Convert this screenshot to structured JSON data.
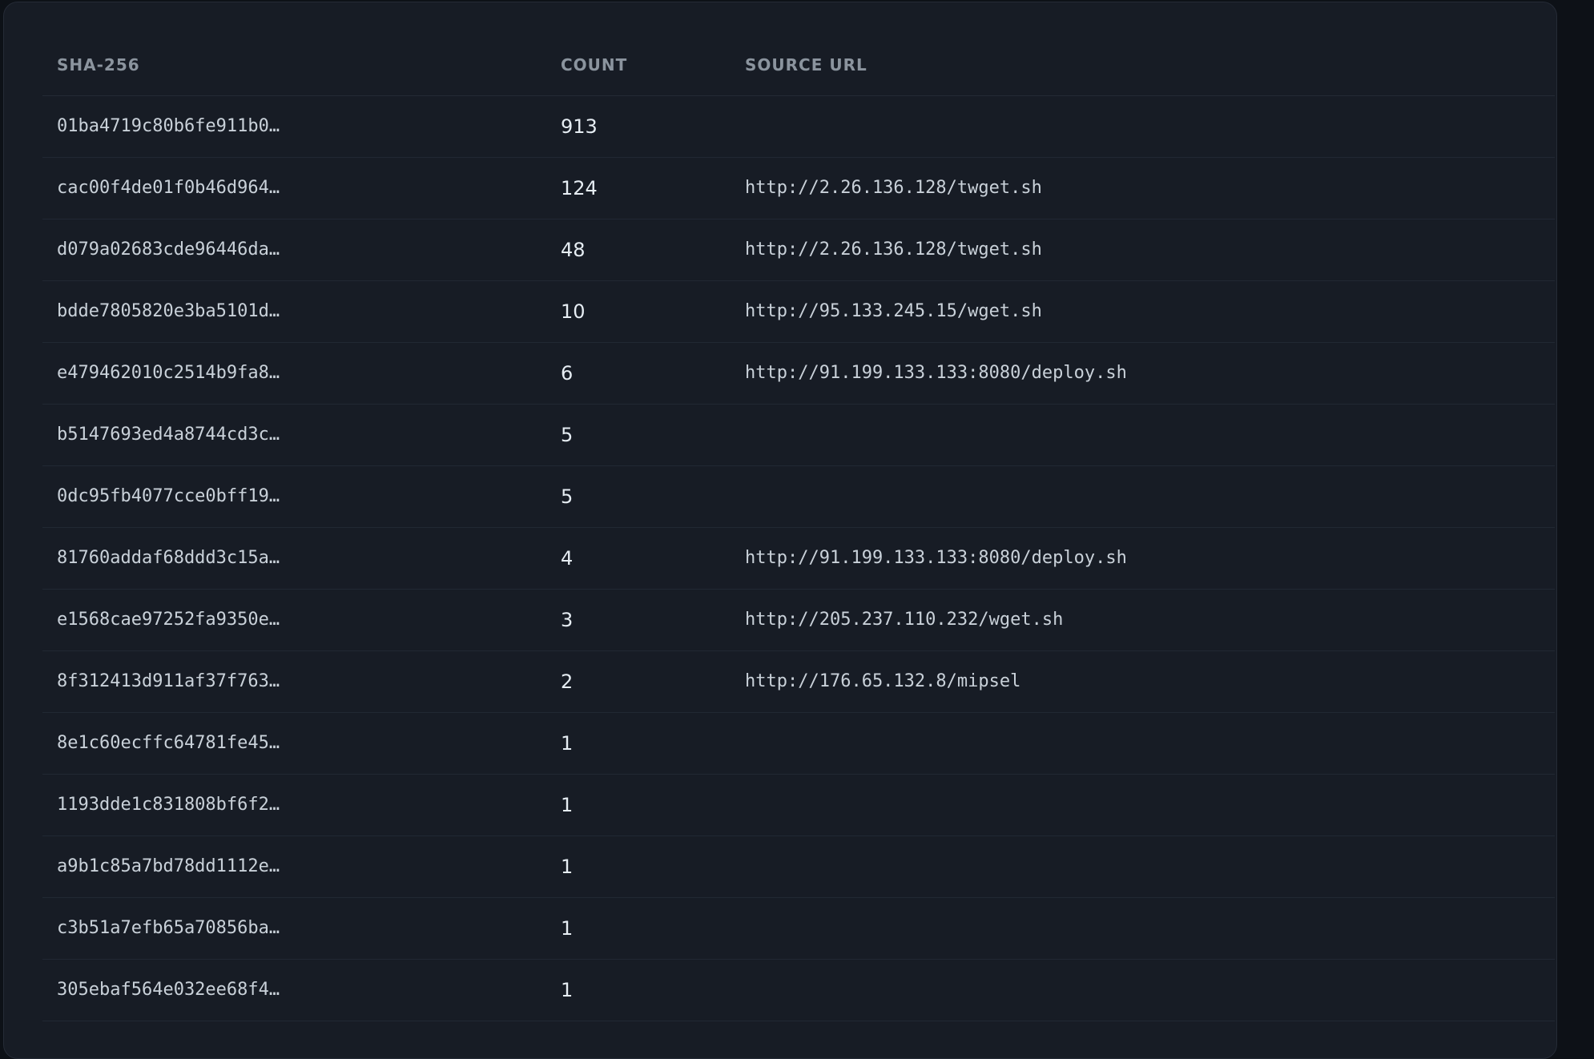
{
  "table": {
    "headers": {
      "sha": "SHA-256",
      "count": "COUNT",
      "url": "SOURCE URL"
    },
    "rows": [
      {
        "sha": "01ba4719c80b6fe911b0…",
        "count": "913",
        "url": ""
      },
      {
        "sha": "cac00f4de01f0b46d964…",
        "count": "124",
        "url": "http://2.26.136.128/twget.sh"
      },
      {
        "sha": "d079a02683cde96446da…",
        "count": "48",
        "url": "http://2.26.136.128/twget.sh"
      },
      {
        "sha": "bdde7805820e3ba5101d…",
        "count": "10",
        "url": "http://95.133.245.15/wget.sh"
      },
      {
        "sha": "e479462010c2514b9fa8…",
        "count": "6",
        "url": "http://91.199.133.133:8080/deploy.sh"
      },
      {
        "sha": "b5147693ed4a8744cd3c…",
        "count": "5",
        "url": ""
      },
      {
        "sha": "0dc95fb4077cce0bff19…",
        "count": "5",
        "url": ""
      },
      {
        "sha": "81760addaf68ddd3c15a…",
        "count": "4",
        "url": "http://91.199.133.133:8080/deploy.sh"
      },
      {
        "sha": "e1568cae97252fa9350e…",
        "count": "3",
        "url": "http://205.237.110.232/wget.sh"
      },
      {
        "sha": "8f312413d911af37f763…",
        "count": "2",
        "url": "http://176.65.132.8/mipsel"
      },
      {
        "sha": "8e1c60ecffc64781fe45…",
        "count": "1",
        "url": ""
      },
      {
        "sha": "1193dde1c831808bf6f2…",
        "count": "1",
        "url": ""
      },
      {
        "sha": "a9b1c85a7bd78dd1112e…",
        "count": "1",
        "url": ""
      },
      {
        "sha": "c3b51a7efb65a70856ba…",
        "count": "1",
        "url": ""
      },
      {
        "sha": "305ebaf564e032ee68f4…",
        "count": "1",
        "url": ""
      }
    ]
  }
}
